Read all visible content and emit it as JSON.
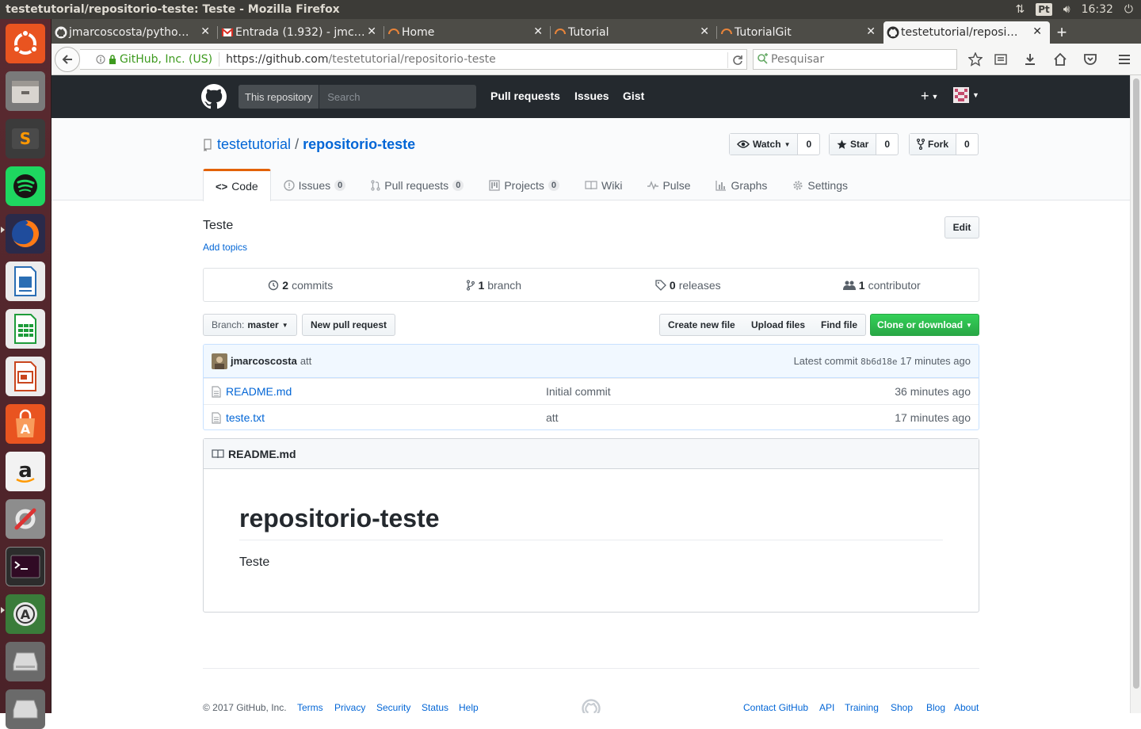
{
  "os": {
    "window_title": "testetutorial/repositorio-teste: Teste - Mozilla Firefox",
    "keyboard_layout": "Pt",
    "clock": "16:32"
  },
  "launcher": {
    "items": [
      "ubuntu-dash",
      "files",
      "sublime-text",
      "spotify",
      "firefox",
      "libreoffice-writer",
      "libreoffice-calc",
      "libreoffice-impress",
      "software-center",
      "amazon",
      "system-settings",
      "terminal",
      "software-updater",
      "disk",
      "removable-drive"
    ]
  },
  "browser": {
    "tabs": [
      {
        "label": "jmarcoscosta/pytho…",
        "favicon": "github-icon"
      },
      {
        "label": "Entrada (1.932) - jmc…",
        "favicon": "gmail-icon"
      },
      {
        "label": "Home",
        "favicon": "loading-icon"
      },
      {
        "label": "Tutorial",
        "favicon": "loading-icon"
      },
      {
        "label": "TutorialGit",
        "favicon": "loading-icon"
      },
      {
        "label": "testetutorial/reposi…",
        "favicon": "github-icon",
        "active": true
      }
    ],
    "identity": "GitHub, Inc. (US)",
    "url_host": "https://github.com",
    "url_path": "/testetutorial/repositorio-teste",
    "search_placeholder": "Pesquisar"
  },
  "github": {
    "header": {
      "scope": "This repository",
      "search_placeholder": "Search",
      "nav": [
        "Pull requests",
        "Issues",
        "Gist"
      ]
    },
    "repo": {
      "owner": "testetutorial",
      "separator": "/",
      "name": "repositorio-teste",
      "watch": {
        "label": "Watch",
        "count": "0"
      },
      "star": {
        "label": "Star",
        "count": "0"
      },
      "fork": {
        "label": "Fork",
        "count": "0"
      }
    },
    "tabs": [
      {
        "label": "Code",
        "icon": "code-icon"
      },
      {
        "label": "Issues",
        "count": "0",
        "icon": "issue-icon"
      },
      {
        "label": "Pull requests",
        "count": "0",
        "icon": "pull-request-icon"
      },
      {
        "label": "Projects",
        "count": "0",
        "icon": "project-icon"
      },
      {
        "label": "Wiki",
        "icon": "book-icon"
      },
      {
        "label": "Pulse",
        "icon": "pulse-icon"
      },
      {
        "label": "Graphs",
        "icon": "graph-icon"
      },
      {
        "label": "Settings",
        "icon": "gear-icon"
      }
    ],
    "description": "Teste",
    "add_topics": "Add topics",
    "edit_label": "Edit",
    "summary": [
      {
        "count": "2",
        "label": "commits"
      },
      {
        "count": "1",
        "label": "branch"
      },
      {
        "count": "0",
        "label": "releases"
      },
      {
        "count": "1",
        "label": "contributor"
      }
    ],
    "branch_prefix": "Branch:",
    "branch_name": "master",
    "new_pull_request": "New pull request",
    "create_new_file": "Create new file",
    "upload_files": "Upload files",
    "find_file": "Find file",
    "clone_or_download": "Clone or download",
    "latest_commit": {
      "author": "jmarcoscosta",
      "message": "att",
      "prefix": "Latest commit",
      "sha": "8b6d18e",
      "age": "17 minutes ago"
    },
    "files": [
      {
        "name": "README.md",
        "message": "Initial commit",
        "age": "36 minutes ago"
      },
      {
        "name": "teste.txt",
        "message": "att",
        "age": "17 minutes ago"
      }
    ],
    "readme": {
      "filename": "README.md",
      "heading": "repositorio-teste",
      "body": "Teste"
    },
    "footer": {
      "copyright": "© 2017 GitHub, Inc.",
      "left_links": [
        "Terms",
        "Privacy",
        "Security",
        "Status",
        "Help"
      ],
      "right_links": [
        "Contact GitHub",
        "API",
        "Training",
        "Shop",
        "Blog",
        "About"
      ]
    }
  }
}
